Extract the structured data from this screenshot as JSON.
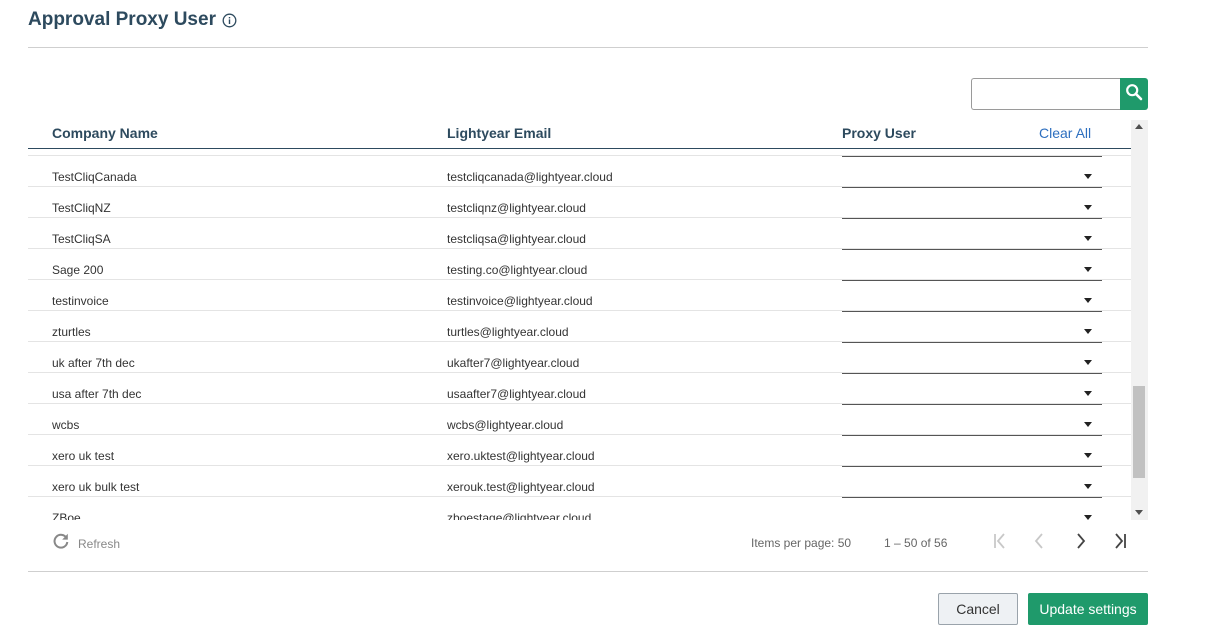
{
  "header": {
    "title": "Approval Proxy User",
    "info_icon": "info-circle-icon"
  },
  "search": {
    "value": "",
    "placeholder": "",
    "icon": "search-icon",
    "accent_color": "#1f9a6b"
  },
  "table": {
    "columns": {
      "company": "Company Name",
      "email": "Lightyear Email",
      "proxy": "Proxy User"
    },
    "clear_all_label": "Clear All",
    "rows": [
      {
        "company": "TestCliqCanada",
        "email": "testcliqcanada@lightyear.cloud",
        "proxy": ""
      },
      {
        "company": "TestCliqNZ",
        "email": "testcliqnz@lightyear.cloud",
        "proxy": ""
      },
      {
        "company": "TestCliqSA",
        "email": "testcliqsa@lightyear.cloud",
        "proxy": ""
      },
      {
        "company": "Sage 200",
        "email": "testing.co@lightyear.cloud",
        "proxy": ""
      },
      {
        "company": "testinvoice",
        "email": "testinvoice@lightyear.cloud",
        "proxy": ""
      },
      {
        "company": "zturtles",
        "email": "turtles@lightyear.cloud",
        "proxy": ""
      },
      {
        "company": "uk after 7th dec",
        "email": "ukafter7@lightyear.cloud",
        "proxy": ""
      },
      {
        "company": "usa after 7th dec",
        "email": "usaafter7@lightyear.cloud",
        "proxy": ""
      },
      {
        "company": "wcbs",
        "email": "wcbs@lightyear.cloud",
        "proxy": ""
      },
      {
        "company": "xero uk test",
        "email": "xero.uktest@lightyear.cloud",
        "proxy": ""
      },
      {
        "company": "xero uk bulk test",
        "email": "xerouk.test@lightyear.cloud",
        "proxy": ""
      },
      {
        "company": "ZBoe",
        "email": "zboestage@lightyear.cloud",
        "proxy": ""
      }
    ]
  },
  "footer": {
    "refresh_label": "Refresh",
    "items_per_page_label": "Items per page:",
    "items_per_page_value": "50",
    "range_label": "1 – 50 of 56"
  },
  "actions": {
    "cancel_label": "Cancel",
    "update_label": "Update settings"
  },
  "colors": {
    "primary": "#1f9a6b",
    "heading": "#2d4a5e",
    "link": "#2d6fbf"
  }
}
